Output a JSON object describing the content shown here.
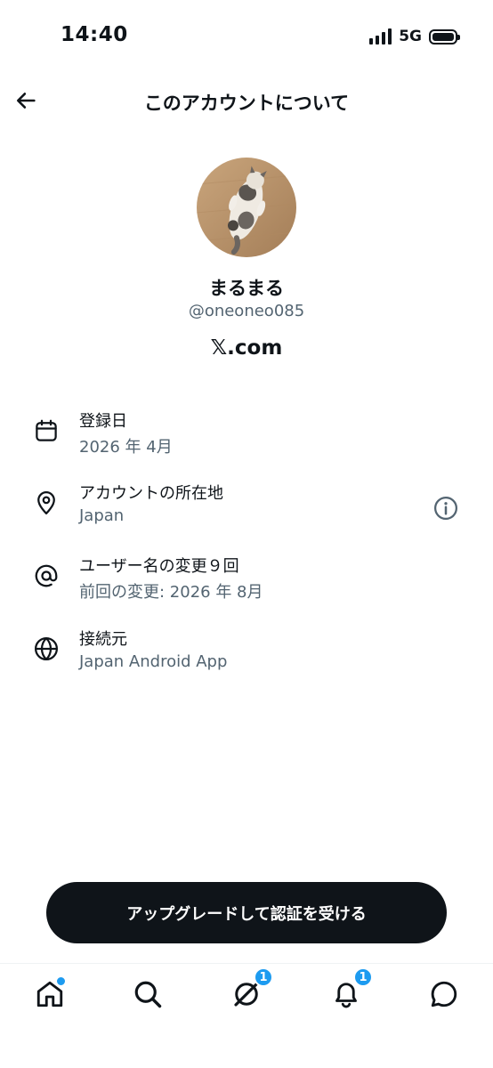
{
  "status_bar": {
    "time": "14:40",
    "network": "5G"
  },
  "header": {
    "title": "このアカウントについて",
    "back_icon": "arrow-left-icon"
  },
  "profile": {
    "display_name": "まるまる",
    "handle": "@oneoneo085",
    "site": "𝕏.com"
  },
  "info_rows": [
    {
      "icon": "calendar-icon",
      "label": "登録日",
      "value": "2026 年 4月"
    },
    {
      "icon": "location-pin-icon",
      "label": "アカウントの所在地",
      "value": "Japan",
      "help_icon": "info-circle-icon"
    },
    {
      "icon": "at-sign-icon",
      "label": "ユーザー名の変更９回",
      "value": "前回の変更: 2026 年 8月"
    },
    {
      "icon": "globe-icon",
      "label": "接続元",
      "value": "Japan Android App"
    }
  ],
  "upgrade_button": {
    "label": "アップグレードして認証を受ける"
  },
  "tab_bar": {
    "home": {
      "icon": "home-icon",
      "has_dot": true
    },
    "search": {
      "icon": "search-icon"
    },
    "grok": {
      "icon": "grok-icon",
      "badge": "1"
    },
    "notifications": {
      "icon": "bell-icon",
      "badge": "1"
    },
    "messages": {
      "icon": "message-bubble-icon"
    }
  },
  "colors": {
    "text_primary": "#0f1419",
    "text_secondary": "#536471",
    "accent": "#1d9bf0",
    "button_bg": "#0f1419"
  }
}
